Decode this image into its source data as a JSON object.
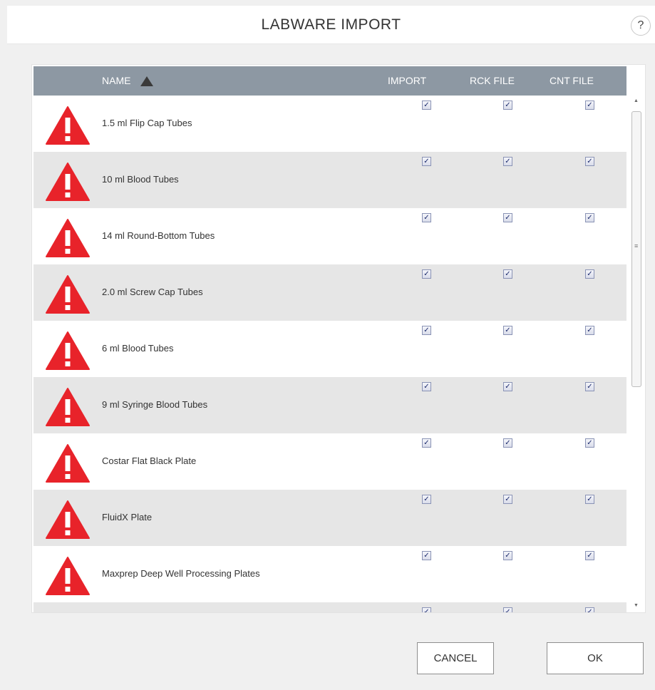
{
  "dialog": {
    "title": "LABWARE IMPORT",
    "help_label": "?"
  },
  "table": {
    "columns": {
      "name": "NAME",
      "import": "IMPORT",
      "rck_file": "RCK FILE",
      "cnt_file": "CNT FILE"
    },
    "sort": {
      "column": "name",
      "direction": "ascending"
    },
    "rows": [
      {
        "name": "1.5 ml Flip Cap Tubes",
        "import": true,
        "rck_file": true,
        "cnt_file": true
      },
      {
        "name": "10 ml Blood Tubes",
        "import": true,
        "rck_file": true,
        "cnt_file": true
      },
      {
        "name": "14 ml Round-Bottom Tubes",
        "import": true,
        "rck_file": true,
        "cnt_file": true
      },
      {
        "name": "2.0 ml Screw Cap Tubes",
        "import": true,
        "rck_file": true,
        "cnt_file": true
      },
      {
        "name": "6 ml Blood Tubes",
        "import": true,
        "rck_file": true,
        "cnt_file": true
      },
      {
        "name": "9 ml Syringe Blood Tubes",
        "import": true,
        "rck_file": true,
        "cnt_file": true
      },
      {
        "name": "Costar Flat Black Plate",
        "import": true,
        "rck_file": true,
        "cnt_file": true
      },
      {
        "name": "FluidX Plate",
        "import": true,
        "rck_file": true,
        "cnt_file": true
      },
      {
        "name": "Maxprep Deep Well Processing Plates",
        "import": true,
        "rck_file": true,
        "cnt_file": true
      },
      {
        "name": "",
        "import": true,
        "rck_file": true,
        "cnt_file": true
      }
    ]
  },
  "icons": {
    "row_status": "warning-icon",
    "sort": "sort-ascending-icon"
  },
  "colors": {
    "warning": "#e8232a",
    "header_bg": "#8d98a3",
    "alt_row": "#e6e6e6"
  },
  "buttons": {
    "cancel": "CANCEL",
    "ok": "OK"
  }
}
